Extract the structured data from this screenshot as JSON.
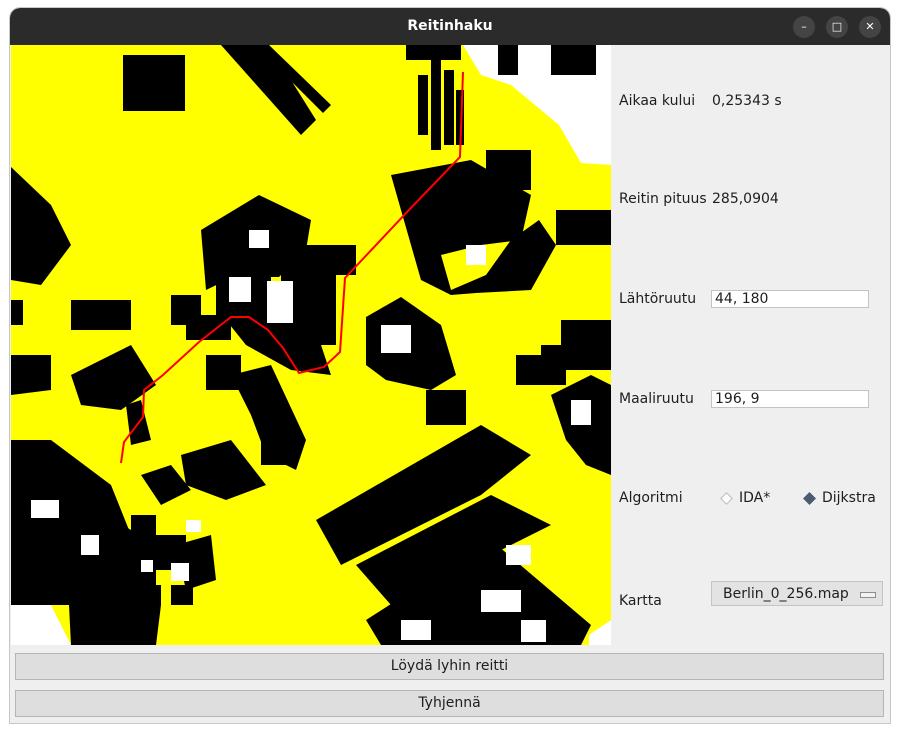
{
  "window": {
    "title": "Reitinhaku"
  },
  "stats": {
    "time_label": "Aikaa kului",
    "time_value": "0,25343 s",
    "length_label": "Reitin pituus",
    "length_value": "285,0904"
  },
  "start": {
    "label": "Lähtöruutu",
    "value": "44, 180"
  },
  "goal": {
    "label": "Maaliruutu",
    "value": "196, 9"
  },
  "algorithm": {
    "label": "Algoritmi",
    "options": [
      "IDA*",
      "Dijkstra"
    ],
    "selected": "Dijkstra"
  },
  "map_select": {
    "label": "Kartta",
    "value": "Berlin_0_256.map"
  },
  "buttons": {
    "find": "Löydä lyhin reitti",
    "clear": "Tyhjennä"
  },
  "map_colors": {
    "explored": "#ffff00",
    "wall": "#000000",
    "free": "#ffffff",
    "path": "#ff0000"
  }
}
